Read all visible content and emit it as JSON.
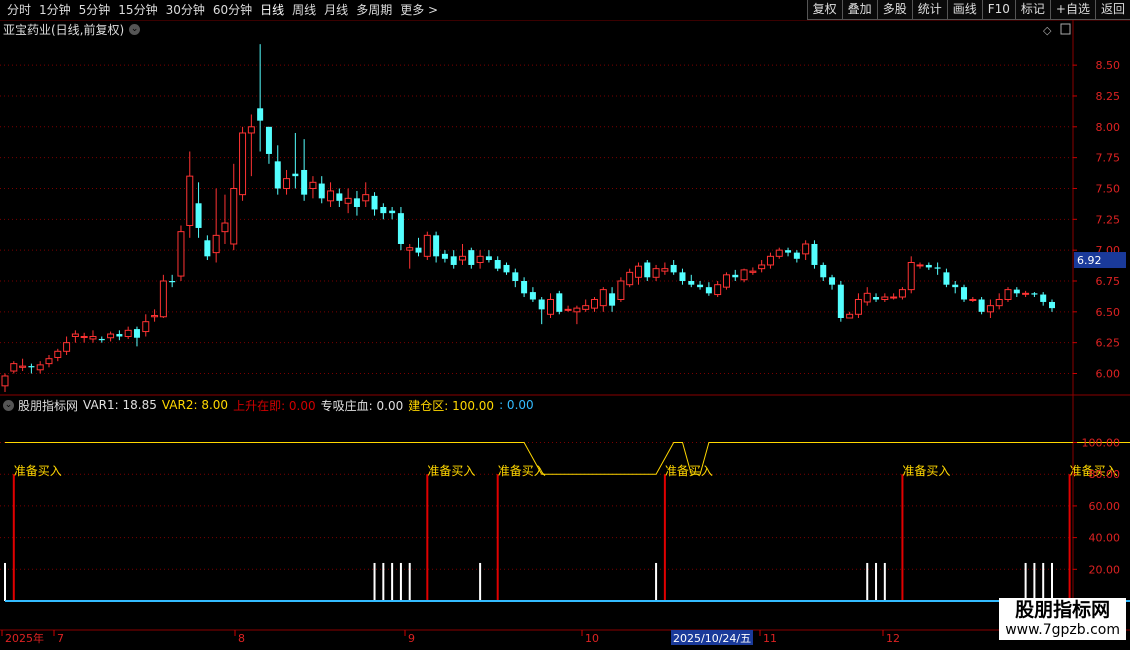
{
  "toolbar": {
    "periods": [
      "分时",
      "1分钟",
      "5分钟",
      "15分钟",
      "30分钟",
      "60分钟",
      "日线",
      "周线",
      "月线",
      "多周期",
      "更多 >"
    ],
    "active_period": "日线",
    "buttons": [
      "复权",
      "叠加",
      "多股",
      "统计",
      "画线",
      "F10",
      "标记",
      "+自选",
      "返回"
    ]
  },
  "chart_title": "亚宝药业(日线,前复权)",
  "price_axis": {
    "ticks": [
      "8.50",
      "8.25",
      "8.00",
      "7.75",
      "7.50",
      "7.25",
      "7.00",
      "6.75",
      "6.50",
      "6.25",
      "6.00"
    ],
    "current_price": "6.92"
  },
  "indicator_header": {
    "name": "股朋指标网",
    "items": [
      {
        "label": "VAR1: 18.85",
        "color": "#e0e0e0"
      },
      {
        "label": "VAR2: 8.00",
        "color": "#ffd700"
      },
      {
        "label": "上升在即: 0.00",
        "color": "#d00000"
      },
      {
        "label": "专吸庄血: 0.00",
        "color": "#e0e0e0"
      },
      {
        "label": "建仓区: 100.00",
        "color": "#ffd700"
      },
      {
        "label": ": 0.00",
        "color": "#33bbff"
      }
    ]
  },
  "indicator_axis": {
    "ticks": [
      "100.00",
      "80.00",
      "60.00",
      "40.00",
      "20.00"
    ]
  },
  "signal_label": "准备买入",
  "date_axis": {
    "labels": [
      "2025年",
      "7",
      "8",
      "9",
      "10",
      "2025/10/24/五",
      "11",
      "12"
    ]
  },
  "watermark": {
    "cn": "股朋指标网",
    "url": "www.7gpzb.com"
  },
  "colors": {
    "up": "#ff3333",
    "down": "#54ffff",
    "grid": "#7a0000",
    "signal": "#ffd700"
  },
  "chart_data": [
    {
      "type": "candlestick",
      "title": "亚宝药业(日线,前复权)",
      "y_ticks": [
        8.5,
        8.25,
        8.0,
        7.75,
        7.5,
        7.25,
        7.0,
        6.75,
        6.5,
        6.25,
        6.0
      ],
      "ylim": [
        5.85,
        8.72
      ],
      "last_price": 6.92,
      "candles": [
        [
          5.9,
          5.98,
          5.85,
          6.0
        ],
        [
          6.02,
          6.08,
          6.0,
          6.1
        ],
        [
          6.05,
          6.06,
          6.02,
          6.12
        ],
        [
          6.06,
          6.05,
          6.0,
          6.08
        ],
        [
          6.03,
          6.07,
          6.0,
          6.1
        ],
        [
          6.08,
          6.12,
          6.05,
          6.15
        ],
        [
          6.13,
          6.18,
          6.1,
          6.2
        ],
        [
          6.18,
          6.25,
          6.15,
          6.3
        ],
        [
          6.3,
          6.32,
          6.25,
          6.35
        ],
        [
          6.3,
          6.3,
          6.25,
          6.33
        ],
        [
          6.28,
          6.3,
          6.25,
          6.35
        ],
        [
          6.28,
          6.27,
          6.25,
          6.3
        ],
        [
          6.29,
          6.32,
          6.26,
          6.34
        ],
        [
          6.32,
          6.3,
          6.27,
          6.35
        ],
        [
          6.3,
          6.35,
          6.28,
          6.38
        ],
        [
          6.36,
          6.29,
          6.22,
          6.38
        ],
        [
          6.34,
          6.42,
          6.3,
          6.48
        ],
        [
          6.46,
          6.47,
          6.42,
          6.52
        ],
        [
          6.46,
          6.75,
          6.45,
          6.8
        ],
        [
          6.75,
          6.74,
          6.7,
          6.8
        ],
        [
          6.79,
          7.15,
          6.75,
          7.2
        ],
        [
          7.2,
          7.6,
          7.1,
          7.8
        ],
        [
          7.38,
          7.18,
          7.1,
          7.55
        ],
        [
          7.08,
          6.95,
          6.92,
          7.12
        ],
        [
          6.98,
          7.12,
          6.9,
          7.5
        ],
        [
          7.15,
          7.22,
          7.05,
          7.45
        ],
        [
          7.05,
          7.5,
          7.0,
          7.7
        ],
        [
          7.45,
          7.95,
          7.4,
          8.0
        ],
        [
          7.95,
          8.0,
          7.6,
          8.1
        ],
        [
          8.15,
          8.05,
          7.8,
          8.67
        ],
        [
          8.0,
          7.78,
          7.7,
          7.98
        ],
        [
          7.72,
          7.5,
          7.45,
          7.85
        ],
        [
          7.5,
          7.58,
          7.45,
          7.65
        ],
        [
          7.62,
          7.6,
          7.5,
          7.95
        ],
        [
          7.65,
          7.45,
          7.4,
          7.9
        ],
        [
          7.5,
          7.55,
          7.42,
          7.6
        ],
        [
          7.54,
          7.42,
          7.38,
          7.6
        ],
        [
          7.4,
          7.48,
          7.35,
          7.55
        ],
        [
          7.46,
          7.4,
          7.35,
          7.5
        ],
        [
          7.38,
          7.42,
          7.3,
          7.5
        ],
        [
          7.42,
          7.35,
          7.28,
          7.48
        ],
        [
          7.4,
          7.45,
          7.35,
          7.55
        ],
        [
          7.44,
          7.33,
          7.28,
          7.47
        ],
        [
          7.35,
          7.3,
          7.25,
          7.38
        ],
        [
          7.32,
          7.3,
          7.25,
          7.35
        ],
        [
          7.3,
          7.05,
          7.0,
          7.35
        ],
        [
          7.0,
          7.02,
          6.85,
          7.05
        ],
        [
          7.02,
          6.98,
          6.95,
          7.1
        ],
        [
          6.95,
          7.12,
          6.92,
          7.15
        ],
        [
          7.12,
          6.95,
          6.9,
          7.15
        ],
        [
          6.97,
          6.93,
          6.9,
          7.0
        ],
        [
          6.95,
          6.88,
          6.85,
          7.0
        ],
        [
          6.92,
          6.95,
          6.88,
          7.05
        ],
        [
          7.0,
          6.88,
          6.85,
          7.02
        ],
        [
          6.9,
          6.95,
          6.85,
          7.0
        ],
        [
          6.95,
          6.92,
          6.9,
          7.0
        ],
        [
          6.92,
          6.85,
          6.83,
          6.95
        ],
        [
          6.88,
          6.82,
          6.8,
          6.9
        ],
        [
          6.82,
          6.75,
          6.7,
          6.85
        ],
        [
          6.75,
          6.65,
          6.62,
          6.78
        ],
        [
          6.66,
          6.6,
          6.58,
          6.7
        ],
        [
          6.6,
          6.52,
          6.4,
          6.62
        ],
        [
          6.48,
          6.6,
          6.45,
          6.65
        ],
        [
          6.65,
          6.5,
          6.48,
          6.67
        ],
        [
          6.52,
          6.52,
          6.5,
          6.55
        ],
        [
          6.5,
          6.53,
          6.4,
          6.55
        ],
        [
          6.52,
          6.55,
          6.5,
          6.6
        ],
        [
          6.53,
          6.6,
          6.5,
          6.62
        ],
        [
          6.55,
          6.68,
          6.5,
          6.7
        ],
        [
          6.65,
          6.55,
          6.5,
          6.7
        ],
        [
          6.6,
          6.75,
          6.58,
          6.78
        ],
        [
          6.72,
          6.82,
          6.7,
          6.85
        ],
        [
          6.78,
          6.87,
          6.72,
          6.9
        ],
        [
          6.9,
          6.78,
          6.75,
          6.92
        ],
        [
          6.78,
          6.85,
          6.75,
          6.88
        ],
        [
          6.83,
          6.85,
          6.8,
          6.9
        ],
        [
          6.88,
          6.82,
          6.8,
          6.92
        ],
        [
          6.82,
          6.75,
          6.72,
          6.85
        ],
        [
          6.75,
          6.72,
          6.7,
          6.8
        ],
        [
          6.72,
          6.7,
          6.68,
          6.75
        ],
        [
          6.7,
          6.65,
          6.63,
          6.74
        ],
        [
          6.64,
          6.72,
          6.62,
          6.75
        ],
        [
          6.7,
          6.8,
          6.68,
          6.82
        ],
        [
          6.8,
          6.78,
          6.75,
          6.84
        ],
        [
          6.76,
          6.84,
          6.74,
          6.85
        ],
        [
          6.82,
          6.83,
          6.8,
          6.86
        ],
        [
          6.85,
          6.88,
          6.82,
          6.92
        ],
        [
          6.88,
          6.95,
          6.85,
          6.98
        ],
        [
          6.95,
          7.0,
          6.93,
          7.02
        ],
        [
          7.0,
          6.98,
          6.95,
          7.02
        ],
        [
          6.98,
          6.93,
          6.9,
          7.0
        ],
        [
          6.97,
          7.05,
          6.92,
          7.08
        ],
        [
          7.05,
          6.88,
          6.85,
          7.08
        ],
        [
          6.88,
          6.78,
          6.75,
          6.9
        ],
        [
          6.78,
          6.72,
          6.68,
          6.8
        ],
        [
          6.72,
          6.45,
          6.42,
          6.75
        ],
        [
          6.45,
          6.48,
          6.45,
          6.5
        ],
        [
          6.48,
          6.6,
          6.45,
          6.65
        ],
        [
          6.58,
          6.65,
          6.55,
          6.7
        ],
        [
          6.62,
          6.6,
          6.58,
          6.65
        ],
        [
          6.6,
          6.62,
          6.58,
          6.65
        ],
        [
          6.62,
          6.62,
          6.6,
          6.65
        ],
        [
          6.62,
          6.68,
          6.6,
          6.7
        ],
        [
          6.68,
          6.9,
          6.65,
          6.95
        ],
        [
          6.88,
          6.88,
          6.85,
          6.9
        ],
        [
          6.88,
          6.86,
          6.84,
          6.9
        ],
        [
          6.86,
          6.85,
          6.8,
          6.9
        ],
        [
          6.82,
          6.72,
          6.7,
          6.85
        ],
        [
          6.72,
          6.7,
          6.65,
          6.75
        ],
        [
          6.7,
          6.6,
          6.58,
          6.72
        ],
        [
          6.6,
          6.6,
          6.58,
          6.62
        ],
        [
          6.6,
          6.5,
          6.48,
          6.62
        ],
        [
          6.5,
          6.55,
          6.45,
          6.6
        ],
        [
          6.55,
          6.6,
          6.52,
          6.65
        ],
        [
          6.6,
          6.68,
          6.58,
          6.7
        ],
        [
          6.68,
          6.65,
          6.62,
          6.7
        ],
        [
          6.65,
          6.65,
          6.62,
          6.67
        ],
        [
          6.65,
          6.64,
          6.62,
          6.66
        ],
        [
          6.64,
          6.58,
          6.55,
          6.66
        ],
        [
          6.58,
          6.53,
          6.5,
          6.6
        ]
      ]
    },
    {
      "type": "indicator",
      "name": "股朋指标网",
      "y_ticks": [
        100,
        80,
        60,
        40,
        20
      ],
      "ylim": [
        0,
        118
      ],
      "lines": {
        "建仓区": {
          "color": "#ffd700",
          "x": [
            0,
            59,
            61,
            74,
            76,
            77,
            78,
            79,
            80,
            147
          ],
          "y": [
            100,
            100,
            80,
            80,
            100,
            100,
            80,
            80,
            100,
            100
          ]
        }
      },
      "buy_signals": [
        1,
        48,
        56,
        75,
        102,
        121,
        141
      ],
      "white_bars": [
        0,
        42,
        43,
        44,
        45,
        46,
        54,
        74,
        98,
        99,
        100,
        116,
        117,
        118,
        119,
        136,
        137,
        138,
        139
      ]
    }
  ]
}
